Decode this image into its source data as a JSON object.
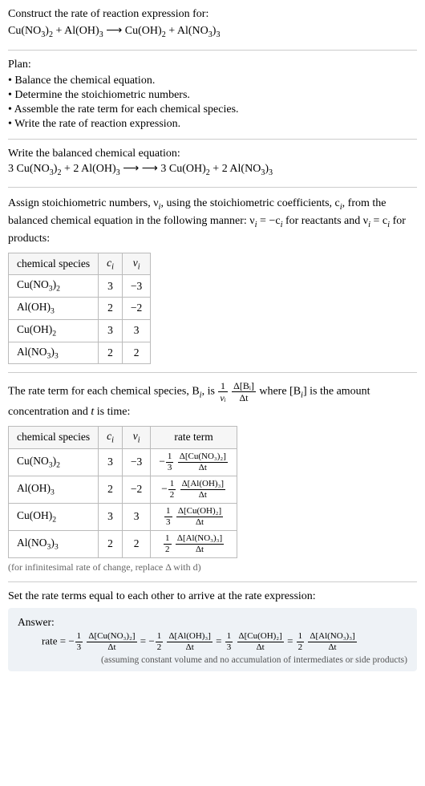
{
  "intro": {
    "prompt": "Construct the rate of reaction expression for:",
    "equation_lhs1": "Cu(NO",
    "equation_lhs1b": "3",
    "equation_lhs1c": ")",
    "equation_lhs1d": "2",
    "equation_plus1": " + Al(OH)",
    "equation_plus1b": "3",
    "equation_arrow": " ⟶ ",
    "equation_rhs1": "Cu(OH)",
    "equation_rhs1b": "2",
    "equation_plus2": " + Al(NO",
    "equation_plus2b": "3",
    "equation_plus2c": ")",
    "equation_plus2d": "3"
  },
  "plan": {
    "title": "Plan:",
    "items": [
      "Balance the chemical equation.",
      "Determine the stoichiometric numbers.",
      "Assemble the rate term for each chemical species.",
      "Write the rate of reaction expression."
    ]
  },
  "balanced": {
    "title": "Write the balanced chemical equation:",
    "c1": "3 Cu(NO",
    "c2": " + 2 Al(OH)",
    "c3": " ⟶ 3 Cu(OH)",
    "c4": " + 2 Al(NO"
  },
  "stoich": {
    "text1": "Assign stoichiometric numbers, ν",
    "text1sub": "i",
    "text1b": ", using the stoichiometric coefficients, c",
    "text1bsub": "i",
    "text1c": ", from the balanced chemical equation in the following manner: ν",
    "text1csub": "i",
    "text1d": " = −c",
    "text1dsub": "i",
    "text1e": " for reactants and ν",
    "text1esub": "i",
    "text1f": " = c",
    "text1fsub": "i",
    "text1g": " for products:",
    "headers": [
      "chemical species",
      "cᵢ",
      "νᵢ"
    ],
    "rows": [
      {
        "species": "Cu(NO₃)₂",
        "c": "3",
        "v": "−3"
      },
      {
        "species": "Al(OH)₃",
        "c": "2",
        "v": "−2"
      },
      {
        "species": "Cu(OH)₂",
        "c": "3",
        "v": "3"
      },
      {
        "species": "Al(NO₃)₃",
        "c": "2",
        "v": "2"
      }
    ]
  },
  "rateterm": {
    "text1": "The rate term for each chemical species, B",
    "text1sub": "i",
    "text1b": ", is ",
    "frac1_num": "1",
    "frac1_den": "νᵢ",
    "frac2_num": "Δ[Bᵢ]",
    "frac2_den": "Δt",
    "text1c": " where [B",
    "text1csub": "i",
    "text1d": "] is the amount concentration and ",
    "text1e": "t",
    "text1f": " is time:",
    "headers": [
      "chemical species",
      "cᵢ",
      "νᵢ",
      "rate term"
    ],
    "rows": [
      {
        "species": "Cu(NO₃)₂",
        "c": "3",
        "v": "−3",
        "sign": "−",
        "fn": "1",
        "fd": "3",
        "dn": "Δ[Cu(NO₃)₂]",
        "dd": "Δt"
      },
      {
        "species": "Al(OH)₃",
        "c": "2",
        "v": "−2",
        "sign": "−",
        "fn": "1",
        "fd": "2",
        "dn": "Δ[Al(OH)₃]",
        "dd": "Δt"
      },
      {
        "species": "Cu(OH)₂",
        "c": "3",
        "v": "3",
        "sign": "",
        "fn": "1",
        "fd": "3",
        "dn": "Δ[Cu(OH)₂]",
        "dd": "Δt"
      },
      {
        "species": "Al(NO₃)₃",
        "c": "2",
        "v": "2",
        "sign": "",
        "fn": "1",
        "fd": "2",
        "dn": "Δ[Al(NO₃)₃]",
        "dd": "Δt"
      }
    ],
    "note": "(for infinitesimal rate of change, replace Δ with d)"
  },
  "final": {
    "title": "Set the rate terms equal to each other to arrive at the rate expression:",
    "answer_label": "Answer:",
    "rate_label": "rate = ",
    "terms": [
      {
        "sign": "−",
        "fn": "1",
        "fd": "3",
        "dn": "Δ[Cu(NO₃)₂]",
        "dd": "Δt"
      },
      {
        "sign": "−",
        "fn": "1",
        "fd": "2",
        "dn": "Δ[Al(OH)₃]",
        "dd": "Δt"
      },
      {
        "sign": "",
        "fn": "1",
        "fd": "3",
        "dn": "Δ[Cu(OH)₂]",
        "dd": "Δt"
      },
      {
        "sign": "",
        "fn": "1",
        "fd": "2",
        "dn": "Δ[Al(NO₃)₃]",
        "dd": "Δt"
      }
    ],
    "assume": "(assuming constant volume and no accumulation of intermediates or side products)"
  },
  "chart_data": {
    "type": "table",
    "tables": [
      {
        "title": "Stoichiometric numbers",
        "columns": [
          "chemical species",
          "c_i",
          "nu_i"
        ],
        "rows": [
          [
            "Cu(NO3)2",
            3,
            -3
          ],
          [
            "Al(OH)3",
            2,
            -2
          ],
          [
            "Cu(OH)2",
            3,
            3
          ],
          [
            "Al(NO3)3",
            2,
            2
          ]
        ]
      },
      {
        "title": "Rate terms",
        "columns": [
          "chemical species",
          "c_i",
          "nu_i",
          "rate term"
        ],
        "rows": [
          [
            "Cu(NO3)2",
            3,
            -3,
            "-(1/3) d[Cu(NO3)2]/dt"
          ],
          [
            "Al(OH)3",
            2,
            -2,
            "-(1/2) d[Al(OH)3]/dt"
          ],
          [
            "Cu(OH)2",
            3,
            3,
            "(1/3) d[Cu(OH)2]/dt"
          ],
          [
            "Al(NO3)3",
            2,
            2,
            "(1/2) d[Al(NO3)3]/dt"
          ]
        ]
      }
    ],
    "rate_expression": "rate = -(1/3) d[Cu(NO3)2]/dt = -(1/2) d[Al(OH)3]/dt = (1/3) d[Cu(OH)2]/dt = (1/2) d[Al(NO3)3]/dt"
  }
}
